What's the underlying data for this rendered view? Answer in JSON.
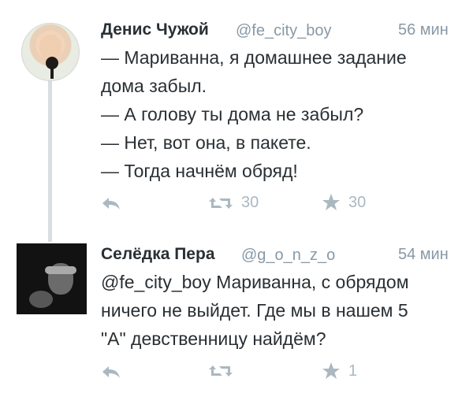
{
  "tweets": [
    {
      "author": "Денис Чужой",
      "handle": "@fe_city_boy",
      "time": "56 мин",
      "lines": [
        "— Мариванна, я домашнее задание",
        "дома забыл.",
        "— А голову ты дома не забыл?",
        "— Нет, вот она, в пакете.",
        "— Тогда начнём обряд!"
      ],
      "retweets": "30",
      "favorites": "30"
    },
    {
      "author": "Селёдка Пера",
      "handle": "@g_o_n_z_o",
      "time": "54 мин",
      "lines": [
        "@fe_city_boy Мариванна, с обрядом",
        "ничего не выйдет. Где мы в нашем 5",
        "\"А\" девственницу найдём?"
      ],
      "retweets": "",
      "favorites": "1"
    }
  ],
  "icons": {
    "reply": "reply-icon",
    "retweet": "retweet-icon",
    "favorite": "star-icon"
  },
  "colors": {
    "name": "#292f33",
    "meta": "#8899a6",
    "action": "#aab8c2",
    "thread_line": "#d8dde1"
  }
}
